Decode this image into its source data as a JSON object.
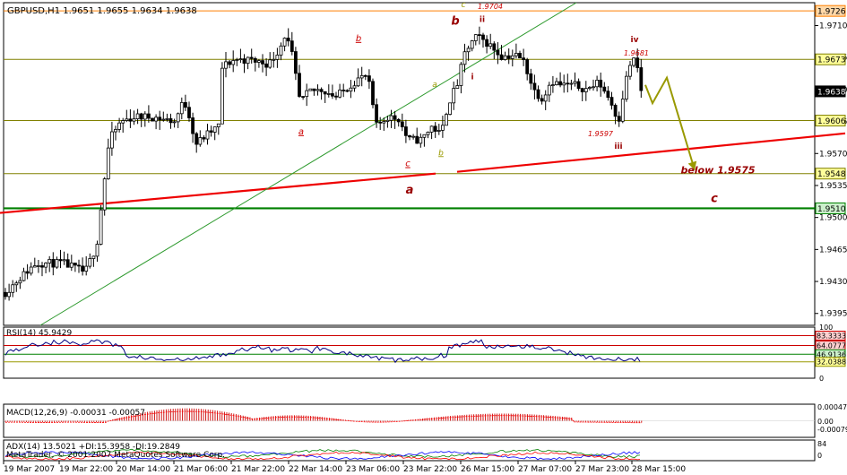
{
  "header": {
    "main": "GBPUSD,H1  1.9651 1.9655 1.9634 1.9638",
    "rsi": "RSI(14) 45.9429",
    "macd": "MACD(12,26,9) -0.00031 -0.00057",
    "adx": "ADX(14) 13.5021 +DI:15.3958 -DI:19.2849",
    "copyright": "MetaTrader, © 2001-2007 MetaQuotes Software Corp."
  },
  "colors": {
    "background": "#ffffff",
    "candle": "#000000",
    "price_level": "#ff7f00",
    "hline": "#808000",
    "trend_red": "#ee0000",
    "support_green": "#008000",
    "channel_green": "#2e9a2e",
    "wave_red": "#cc0000",
    "forecast": "#999900",
    "rsi_line": "#000080",
    "macd_bars": "#cc0000",
    "macd_signal": "#ff0000",
    "adx_line": "#008000",
    "di_plus": "#0000ff",
    "di_minus": "#ff0000"
  },
  "chart_data": [
    {
      "type": "candlestick",
      "title": "GBPUSD,H1",
      "ohlc_last": {
        "open": 1.9651,
        "high": 1.9655,
        "low": 1.9634,
        "close": 1.9638
      },
      "x_labels": [
        "19 Mar 2007",
        "19 Mar 22:00",
        "20 Mar 14:00",
        "21 Mar 06:00",
        "21 Mar 22:00",
        "22 Mar 14:00",
        "23 Mar 06:00",
        "23 Mar 22:00",
        "26 Mar 15:00",
        "27 Mar 07:00",
        "27 Mar 23:00",
        "28 Mar 15:00"
      ],
      "y_ticks": [
        1.9395,
        1.943,
        1.9465,
        1.95,
        1.9535,
        1.957,
        1.9605,
        1.964,
        1.9675,
        1.971
      ],
      "ylim": [
        1.9382,
        1.9735
      ],
      "price_labels": [
        {
          "value": 1.9726,
          "text": "1.9726",
          "style": "orange"
        },
        {
          "value": 1.9673,
          "text": "1.9673",
          "style": "olive"
        },
        {
          "value": 1.9638,
          "text": "1.9638",
          "style": "current"
        },
        {
          "value": 1.9606,
          "text": "1.9606",
          "style": "olive"
        },
        {
          "value": 1.9548,
          "text": "1.9548",
          "style": "olive"
        },
        {
          "value": 1.951,
          "text": "1.9510",
          "style": "green"
        }
      ],
      "hlines": [
        {
          "value": 1.9726,
          "style": "orange"
        },
        {
          "value": 1.9673,
          "style": "olive"
        },
        {
          "value": 1.9606,
          "style": "olive"
        },
        {
          "value": 1.9548,
          "style": "olive"
        },
        {
          "value": 1.951,
          "style": "green"
        }
      ],
      "trend_lines": [
        {
          "style": "red",
          "x1": 0,
          "y1": 1.9505,
          "x2": 486,
          "y2": 1.9548
        },
        {
          "style": "red",
          "x1": 510,
          "y1": 1.955,
          "x2": 943,
          "y2": 1.9592
        },
        {
          "style": "channel",
          "x1": 45,
          "y1": 1.9382,
          "x2": 643,
          "y2": 1.9735
        }
      ],
      "forecast_path": [
        [
          720,
          1.9645
        ],
        [
          728,
          1.9625
        ],
        [
          744,
          1.9653
        ],
        [
          775,
          1.9552
        ]
      ],
      "annotations": [
        {
          "text": "c",
          "x": 517,
          "y": 1.973,
          "style": "olive"
        },
        {
          "text": "1.9704",
          "x": 547,
          "y": 1.9728,
          "style": "red"
        },
        {
          "text": "b",
          "x": 508,
          "y": 1.9711,
          "style": "wave"
        },
        {
          "text": "ii",
          "x": 538,
          "y": 1.9714,
          "style": "wave_small"
        },
        {
          "text": "b",
          "x": 400,
          "y": 1.9693,
          "style": "red_under"
        },
        {
          "text": "iv",
          "x": 708,
          "y": 1.9692,
          "style": "wave_small"
        },
        {
          "text": "1.9681",
          "x": 710,
          "y": 1.9677,
          "style": "red"
        },
        {
          "text": "a",
          "x": 485,
          "y": 1.9643,
          "style": "olive"
        },
        {
          "text": "i",
          "x": 527,
          "y": 1.9651,
          "style": "wave_small"
        },
        {
          "text": "a",
          "x": 336,
          "y": 1.9591,
          "style": "red_under"
        },
        {
          "text": "1.9597",
          "x": 670,
          "y": 1.9589,
          "style": "red"
        },
        {
          "text": "iii",
          "x": 690,
          "y": 1.9575,
          "style": "wave_small"
        },
        {
          "text": "c",
          "x": 455,
          "y": 1.9556,
          "style": "red_under"
        },
        {
          "text": "b",
          "x": 492,
          "y": 1.9568,
          "style": "olive_under"
        },
        {
          "text": "a",
          "x": 457,
          "y": 1.9526,
          "style": "wave"
        },
        {
          "text": "below 1.9575",
          "x": 801,
          "y": 1.9548,
          "style": "wave_label"
        },
        {
          "text": "c",
          "x": 797,
          "y": 1.9517,
          "style": "wave"
        }
      ]
    },
    {
      "type": "line",
      "title": "RSI(14) 45.9429",
      "ylim": [
        0,
        100
      ],
      "y_ticks": [
        100,
        70,
        30,
        0
      ],
      "levels": [
        {
          "value": 83.3333,
          "text": "83.3333",
          "style": "red"
        },
        {
          "value": 64.0777,
          "text": "64.0777",
          "style": "red"
        },
        {
          "value": 46.9136,
          "text": "46.9136",
          "style": "green"
        },
        {
          "value": 32.0388,
          "text": "32.0388",
          "style": "olive"
        }
      ],
      "last_value": 45.9429
    },
    {
      "type": "bar",
      "title": "MACD(12,26,9) -0.00031 -0.00057",
      "ylim": [
        -0.0006,
        0.0006
      ],
      "y_ticks": [
        0.00047,
        0.0,
        -0.00079
      ],
      "y_tick_labels": [
        "0.00047",
        "0.00",
        "-0.00079"
      ],
      "last_macd": -0.00031,
      "last_signal": -0.00057
    },
    {
      "type": "line",
      "title": "ADX(14) 13.5021 +DI:15.3958 -DI:19.2849",
      "ylim": [
        0,
        100
      ],
      "y_ticks": [
        84,
        0
      ],
      "y_tick_labels": [
        "84",
        "0"
      ],
      "last_adx": 13.5021,
      "last_di_plus": 15.3958,
      "last_di_minus": 19.2849
    }
  ]
}
